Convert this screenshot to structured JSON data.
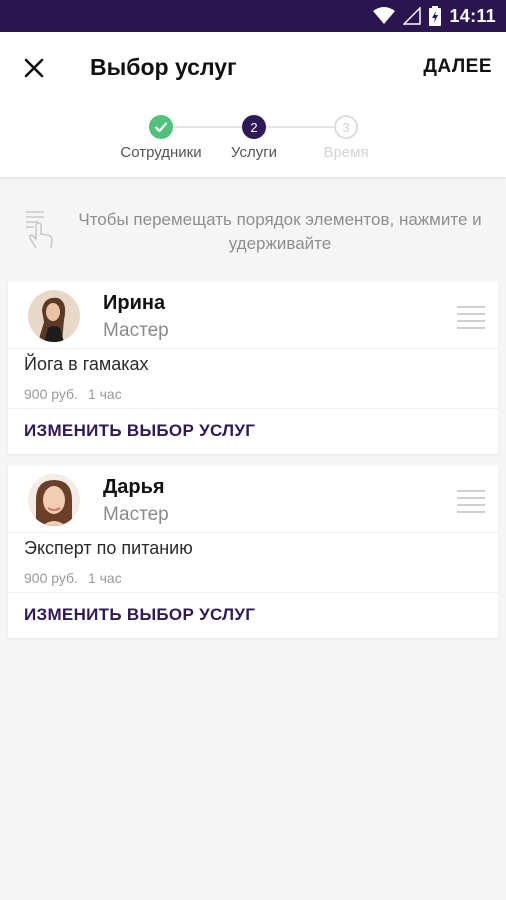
{
  "status_bar": {
    "time": "14:11",
    "icons": [
      "wifi-icon",
      "signal-icon",
      "battery-icon"
    ]
  },
  "header": {
    "title": "Выбор услуг",
    "next_label": "ДАЛЕЕ",
    "close_icon": "close-icon"
  },
  "stepper": {
    "steps": [
      {
        "label": "Сотрудники",
        "state": "done",
        "marker": ""
      },
      {
        "label": "Услуги",
        "state": "active",
        "marker": "2"
      },
      {
        "label": "Время",
        "state": "upcoming",
        "marker": "3"
      }
    ]
  },
  "hint": {
    "text": "Чтобы перемещать порядок элементов, нажмите и удерживайте",
    "icon": "touch-hold-icon"
  },
  "cards": [
    {
      "name": "Ирина",
      "role": "Мастер",
      "service": "Йога в гамаках",
      "price": "900 руб.",
      "duration": "1 час",
      "change_label": "ИЗМЕНИТЬ ВЫБОР УСЛУГ"
    },
    {
      "name": "Дарья",
      "role": "Мастер",
      "service": "Эксперт по питанию",
      "price": "900 руб.",
      "duration": "1 час",
      "change_label": "ИЗМЕНИТЬ ВЫБОР УСЛУГ"
    }
  ],
  "colors": {
    "status_bar": "#2a1550",
    "accent": "#2f1a57",
    "success": "#4fc27c"
  }
}
